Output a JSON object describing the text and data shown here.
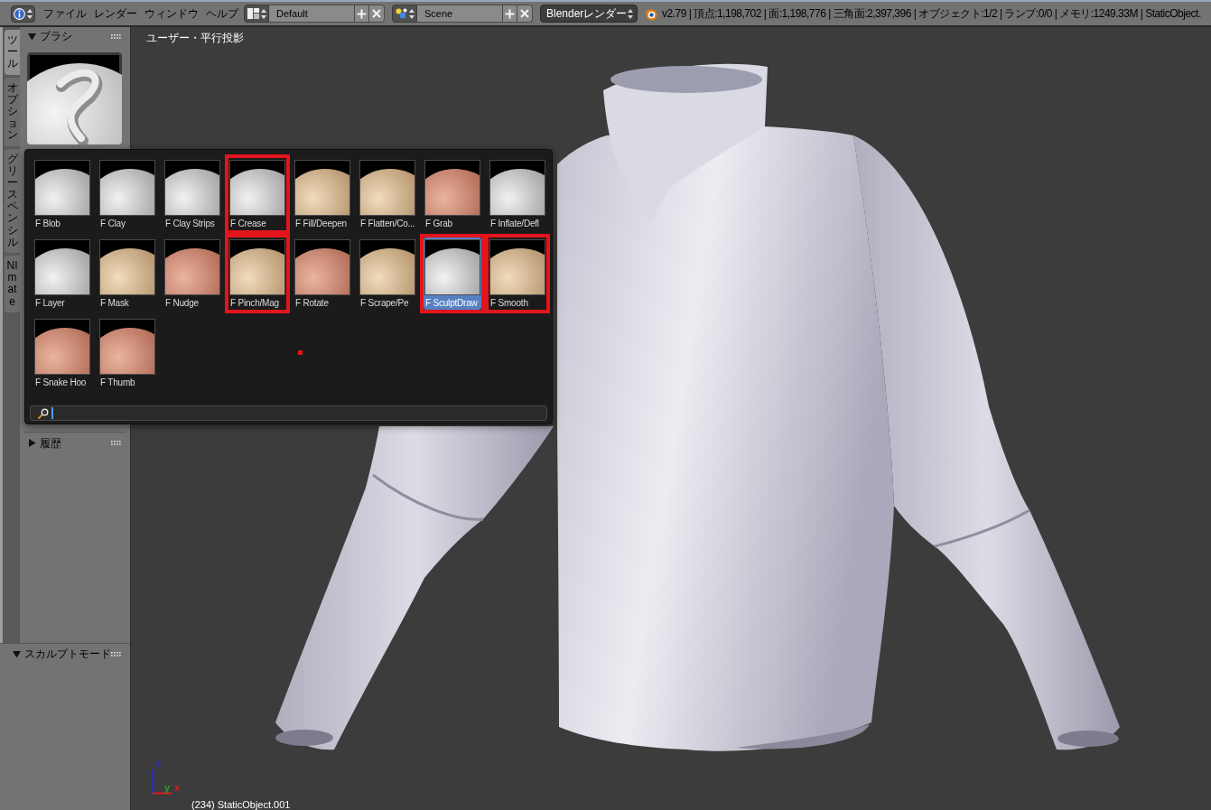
{
  "top_bar": {
    "menus": [
      "ファイル",
      "レンダー",
      "ウィンドウ",
      "ヘルプ"
    ],
    "layout": {
      "value": "Default"
    },
    "scene": {
      "value": "Scene"
    },
    "render_engine": {
      "value": "Blenderレンダー"
    },
    "stats": "v2.79 | 頂点:1,198,702 | 面:1,198,776 | 三角面:2,397,396 | オブジェクト:1/2 | ランプ:0/0 | メモリ:1249.33M | StaticObject."
  },
  "tool_shelf": {
    "tabs": [
      {
        "label": "ツール",
        "selected": true
      },
      {
        "label": "オプション",
        "selected": false
      },
      {
        "label": "グリースペンシル",
        "selected": false
      },
      {
        "label": "NI mate",
        "selected": false
      }
    ],
    "panels": [
      {
        "title": "ブラシ",
        "expanded": true
      },
      {
        "title": "履歴",
        "expanded": false
      }
    ]
  },
  "brush_popup": {
    "brushes": [
      {
        "label": "F Blob",
        "selected": false,
        "highlighted": false
      },
      {
        "label": "F Clay",
        "selected": false,
        "highlighted": false
      },
      {
        "label": "F Clay Strips",
        "selected": false,
        "highlighted": false
      },
      {
        "label": "F Crease",
        "selected": false,
        "highlighted": true
      },
      {
        "label": "F Fill/Deepen",
        "selected": false,
        "highlighted": false
      },
      {
        "label": "F Flatten/Co...",
        "selected": false,
        "highlighted": false
      },
      {
        "label": "F Grab",
        "selected": false,
        "highlighted": false
      },
      {
        "label": "F Inflate/Defl",
        "selected": false,
        "highlighted": false
      },
      {
        "label": "F Layer",
        "selected": false,
        "highlighted": false
      },
      {
        "label": "F Mask",
        "selected": false,
        "highlighted": false
      },
      {
        "label": "F Nudge",
        "selected": false,
        "highlighted": false
      },
      {
        "label": "F Pinch/Mag",
        "selected": false,
        "highlighted": true
      },
      {
        "label": "F Rotate",
        "selected": false,
        "highlighted": false
      },
      {
        "label": "F Scrape/Pe",
        "selected": false,
        "highlighted": false
      },
      {
        "label": "F SculptDraw",
        "selected": true,
        "highlighted": true
      },
      {
        "label": "F Smooth",
        "selected": false,
        "highlighted": true
      },
      {
        "label": "F Snake Hoo",
        "selected": false,
        "highlighted": false
      },
      {
        "label": "F Thumb",
        "selected": false,
        "highlighted": false
      }
    ],
    "search": {
      "focused": true
    }
  },
  "viewport": {
    "view_label": "ユーザー・平行投影",
    "axes": [
      {
        "label": "z",
        "kind": "up",
        "color": "#2a2ad8"
      },
      {
        "label": "y",
        "kind": "depth",
        "color": "#22a022"
      },
      {
        "label": "x",
        "kind": "right",
        "color": "#d42020"
      }
    ],
    "object_label": "(234) StaticObject.001"
  },
  "mode_panel": {
    "title": "スカルプトモード",
    "expanded": true
  }
}
